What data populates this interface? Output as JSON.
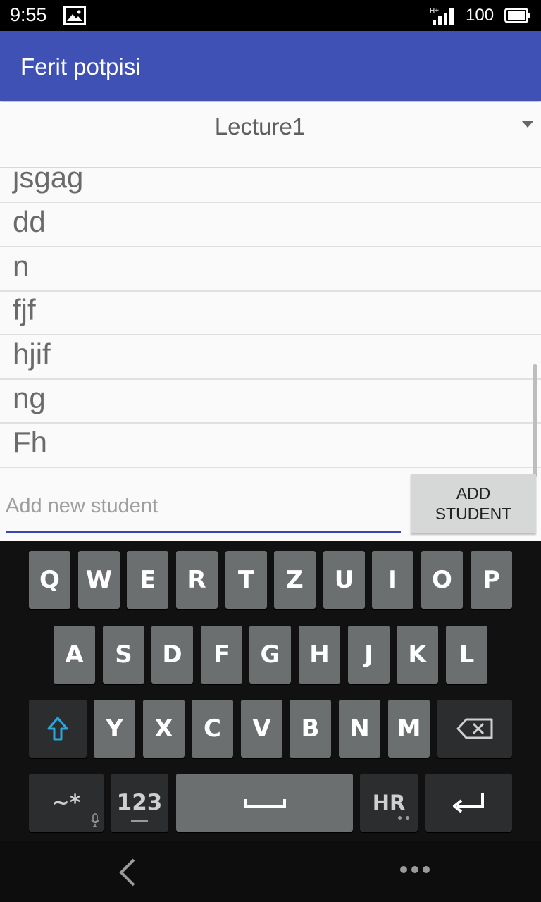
{
  "status_bar": {
    "time": "9:55",
    "network": "H+",
    "battery": "100"
  },
  "app_bar": {
    "title": "Ferit potpisi"
  },
  "spinner": {
    "selected": "Lecture1"
  },
  "students": [
    "jsgag",
    "dd",
    "n",
    "fjf",
    "hjif",
    "ng",
    "Fh"
  ],
  "input": {
    "placeholder": "Add new student",
    "value": ""
  },
  "add_button": {
    "line1": "ADD",
    "line2": "STUDENT"
  },
  "keyboard": {
    "row1": [
      "Q",
      "W",
      "E",
      "R",
      "T",
      "Z",
      "U",
      "I",
      "O",
      "P"
    ],
    "row2": [
      "A",
      "S",
      "D",
      "F",
      "G",
      "H",
      "J",
      "K",
      "L"
    ],
    "row3": [
      "Y",
      "X",
      "C",
      "V",
      "B",
      "N",
      "M"
    ],
    "symbols_label": "~*",
    "numbers_label": "123",
    "language_label": "HR"
  },
  "colors": {
    "primary": "#3f51b5",
    "accent": "#3949ab",
    "shift_icon": "#29a8e0"
  },
  "icons": {
    "status": [
      "gallery-icon",
      "signal-icon",
      "battery-icon"
    ],
    "keyboard": [
      "shift-icon",
      "backspace-icon",
      "space-icon",
      "enter-icon",
      "mic-icon"
    ],
    "nav": [
      "back-icon",
      "more-icon"
    ]
  }
}
